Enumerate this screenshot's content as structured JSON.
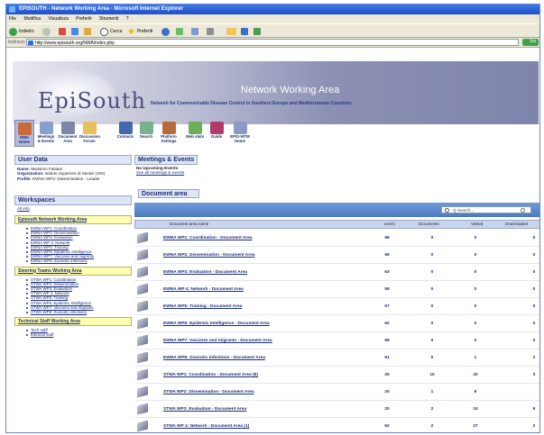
{
  "window": {
    "title": "EPISOUTH - Network Working Area - Microsoft Internet Explorer",
    "menu": [
      "File",
      "Modifica",
      "Visualizza",
      "Preferiti",
      "Strumenti",
      "?"
    ]
  },
  "toolbar": {
    "back_label": "Indietro",
    "search_label": "Cerca",
    "favorites_label": "Preferiti"
  },
  "address": {
    "label": "Indirizzo",
    "url": "http://www.episouth.org/NWA/index.php",
    "go_label": "Vai"
  },
  "banner": {
    "logo": "EpiSouth",
    "title": "Network Working Area",
    "subtitle": "Network for Communicable Disease Control in Southern Europe and Mediterranean Countries"
  },
  "nav": [
    {
      "label": "NWA Home"
    },
    {
      "label": "Meetings & Events"
    },
    {
      "label": "Document Area"
    },
    {
      "label": "Discussion Forum"
    },
    {
      "label": "Contacts"
    },
    {
      "label": "Search"
    },
    {
      "label": "Platform Settings"
    },
    {
      "label": "Web stats"
    },
    {
      "label": "Guide"
    },
    {
      "label": "EPIS-WTM Home"
    }
  ],
  "user": {
    "heading": "User Data",
    "name_key": "Name:",
    "name": "Massimo Fabiani",
    "org_key": "Organization:",
    "org": "Istituto Superiore di Sanita' (ISS)",
    "profile_key": "Profile:",
    "profile": "EWNA WP2: Dissemination - Leader"
  },
  "workspaces": {
    "heading": "Workspaces",
    "all_info": "All info",
    "groups": [
      {
        "title": "Episouth Network Working Area",
        "items": [
          "EWNA WP1: Coordination",
          "EWNA WP2: Dissemination",
          "EWNA WP3: Evaluation",
          "EWNA WP 4: Network",
          "EWNA WP5: Training",
          "EWNA WP6: Epidemic Intelligence",
          "EWNA WP7: Vaccines and migrants",
          "EWNA WP8: Zoonotic infections"
        ]
      },
      {
        "title": "Steering Teams Working Area",
        "items": [
          "STWA WP1: Coordination",
          "STWA WP2: Dissemination",
          "STWA WP3: Evaluation",
          "STWA WP 4: Network",
          "STWA WP5: Training",
          "STWA WP6: Epidemic Intelligence",
          "STWA WP7: Vaccines and migrants",
          "STWA WP8: Zoonotic infections"
        ]
      },
      {
        "title": "Technical Staff Working Area",
        "items": [
          "Tech staff",
          "Editorial staff"
        ]
      }
    ]
  },
  "meetings": {
    "heading": "Meetings & Events",
    "none": "No Upcoming Events",
    "see_all": "See all meetings & events"
  },
  "document_area": {
    "heading": "Document area",
    "search_placeholder": "Q Search...",
    "columns": [
      "Document area name",
      "Users",
      "Documents",
      "Visited",
      "Downloaded"
    ],
    "rows": [
      {
        "name": "EWNA WP1: Coordination - Document Area",
        "users": "68",
        "documents": "0",
        "visited": "0",
        "downloaded": "0"
      },
      {
        "name": "EWNA WP2: Dissemination - Document Area",
        "users": "66",
        "documents": "0",
        "visited": "0",
        "downloaded": "0"
      },
      {
        "name": "EWNA WP3: Evaluation - Document Area",
        "users": "63",
        "documents": "0",
        "visited": "0",
        "downloaded": "0"
      },
      {
        "name": "EWNA WP 4: Network - Document Area",
        "users": "59",
        "documents": "0",
        "visited": "0",
        "downloaded": "0"
      },
      {
        "name": "EWNA WP5: Training - Document Area",
        "users": "57",
        "documents": "0",
        "visited": "0",
        "downloaded": "0"
      },
      {
        "name": "EWNA WP6: Epidemic Intelligence - Document Area",
        "users": "62",
        "documents": "0",
        "visited": "0",
        "downloaded": "0"
      },
      {
        "name": "EWNA WP7: Vaccines and migrants - Document Area",
        "users": "58",
        "documents": "0",
        "visited": "0",
        "downloaded": "0"
      },
      {
        "name": "EWNA WP8: Zoonotic infections - Document Area",
        "users": "61",
        "documents": "0",
        "visited": "1",
        "downloaded": "2"
      },
      {
        "name": "STWA WP1: Coordination - Document Area (8)",
        "users": "20",
        "documents": "10",
        "visited": "32",
        "downloaded": "3"
      },
      {
        "name": "STWA WP2: Dissemination - Document Area",
        "users": "20",
        "documents": "1",
        "visited": "6",
        "downloaded": ""
      },
      {
        "name": "STWA WP3: Evaluation - Document Area",
        "users": "20",
        "documents": "2",
        "visited": "24",
        "downloaded": "6"
      },
      {
        "name": "STWA WP 4: Network - Document Area (1)",
        "users": "62",
        "documents": "2",
        "visited": "27",
        "downloaded": "2"
      }
    ]
  },
  "colors": {
    "titlebar": "#2459d6",
    "link": "#1a2d78",
    "header_band": "#5c87cc",
    "group_box": "#ffffb0"
  }
}
